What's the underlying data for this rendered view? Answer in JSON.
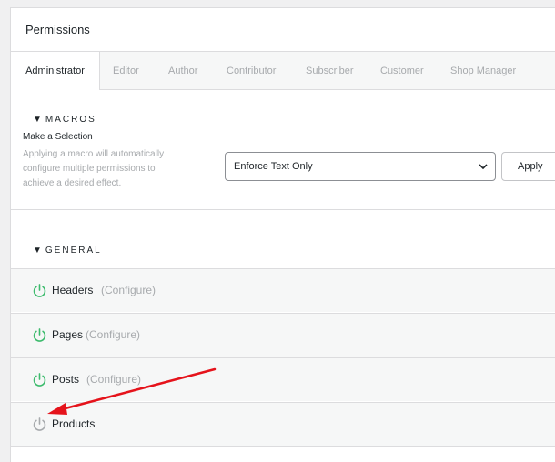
{
  "panel": {
    "title": "Permissions"
  },
  "tabs": [
    {
      "label": "Administrator",
      "active": true
    },
    {
      "label": "Editor"
    },
    {
      "label": "Author"
    },
    {
      "label": "Contributor"
    },
    {
      "label": "Subscriber"
    },
    {
      "label": "Customer"
    },
    {
      "label": "Shop Manager"
    }
  ],
  "macros": {
    "heading": "MACROS",
    "caret": "▼",
    "label": "Make a Selection",
    "description": "Applying a macro will automatically configure multiple permissions to achieve a desired effect.",
    "selected": "Enforce Text Only",
    "apply_label": "Apply"
  },
  "general": {
    "heading": "GENERAL",
    "caret": "▼",
    "items": [
      {
        "name": "Headers",
        "configure": "(Configure)",
        "enabled": true
      },
      {
        "name": "Pages",
        "configure": "(Configure)",
        "enabled": true
      },
      {
        "name": "Posts",
        "configure": "(Configure)",
        "enabled": true
      },
      {
        "name": "Products",
        "configure": "",
        "enabled": false
      }
    ]
  },
  "colors": {
    "enabled_icon": "#3dbb6d",
    "disabled_icon": "#a7aaad",
    "annotation_arrow": "#e5131b"
  },
  "icons": {
    "toggle": "power-icon",
    "select_arrow": "chevron-down-icon"
  }
}
